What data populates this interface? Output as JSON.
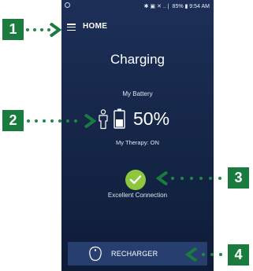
{
  "status_bar": {
    "right_text": "✱ ▣ ✕ ..❘ 85% ▮ 9:54 AM"
  },
  "app_bar": {
    "title": "HOME"
  },
  "main": {
    "charging_label": "Charging",
    "battery_label": "My Battery",
    "battery_percent": "50%",
    "battery_level": 0.5,
    "therapy_status": "My Therapy: ON",
    "connection_status": "Excellent Connection"
  },
  "recharger_button": {
    "label": "RECHARGER"
  },
  "callouts": {
    "c1": "1",
    "c2": "2",
    "c3": "3",
    "c4": "4"
  },
  "icons": {
    "menu": "menu-icon",
    "person": "person-icon",
    "battery": "battery-icon",
    "check": "check-icon",
    "recharger": "recharger-device-icon"
  },
  "colors": {
    "screen_background": "#142546",
    "callout_green": "#1a7b3f",
    "check_green": "#8ec63f",
    "button_background": "#263f6e"
  }
}
